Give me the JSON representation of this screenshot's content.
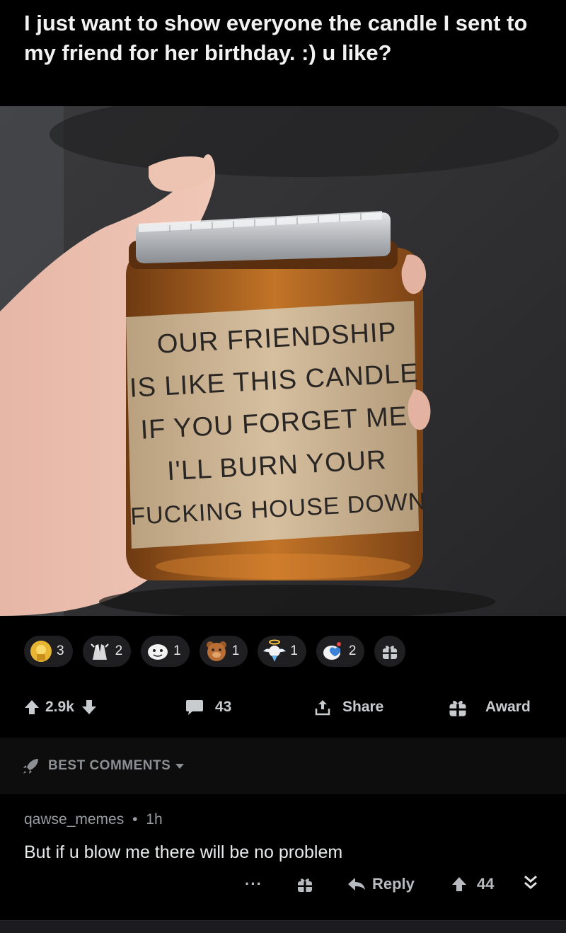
{
  "post": {
    "title": "I just want to show everyone the candle I sent to my friend for her birthday. :) u like?"
  },
  "image": {
    "label_lines": [
      "OUR FRIENDSHIP",
      "IS LIKE THIS CANDLE",
      "IF YOU FORGET ME",
      "I'LL BURN YOUR",
      "FUCKING HOUSE DOWN"
    ]
  },
  "awards": [
    {
      "icon": "helpful-award-icon",
      "count": "3"
    },
    {
      "icon": "praise-hands-award-icon",
      "count": "2"
    },
    {
      "icon": "face-award-icon",
      "count": "1"
    },
    {
      "icon": "bear-award-icon",
      "count": "1"
    },
    {
      "icon": "angel-award-icon",
      "count": "1"
    },
    {
      "icon": "heart-love-award-icon",
      "count": "2"
    }
  ],
  "actions": {
    "votes": "2.9k",
    "comments": "43",
    "share_label": "Share",
    "award_label": "Award"
  },
  "sort": {
    "label": "BEST COMMENTS"
  },
  "comment": {
    "author": "qawse_memes",
    "separator": "•",
    "age": "1h",
    "body": "But if u blow me there will be no problem",
    "more": "···",
    "reply_label": "Reply",
    "votes": "44"
  },
  "colors": {
    "background": "#000000",
    "text_primary": "#f2f2f2",
    "text_secondary": "#9a9da1",
    "pill_bg": "#1f1f21",
    "label_paper": "#c9ad8c",
    "wax": "#b9651c"
  }
}
